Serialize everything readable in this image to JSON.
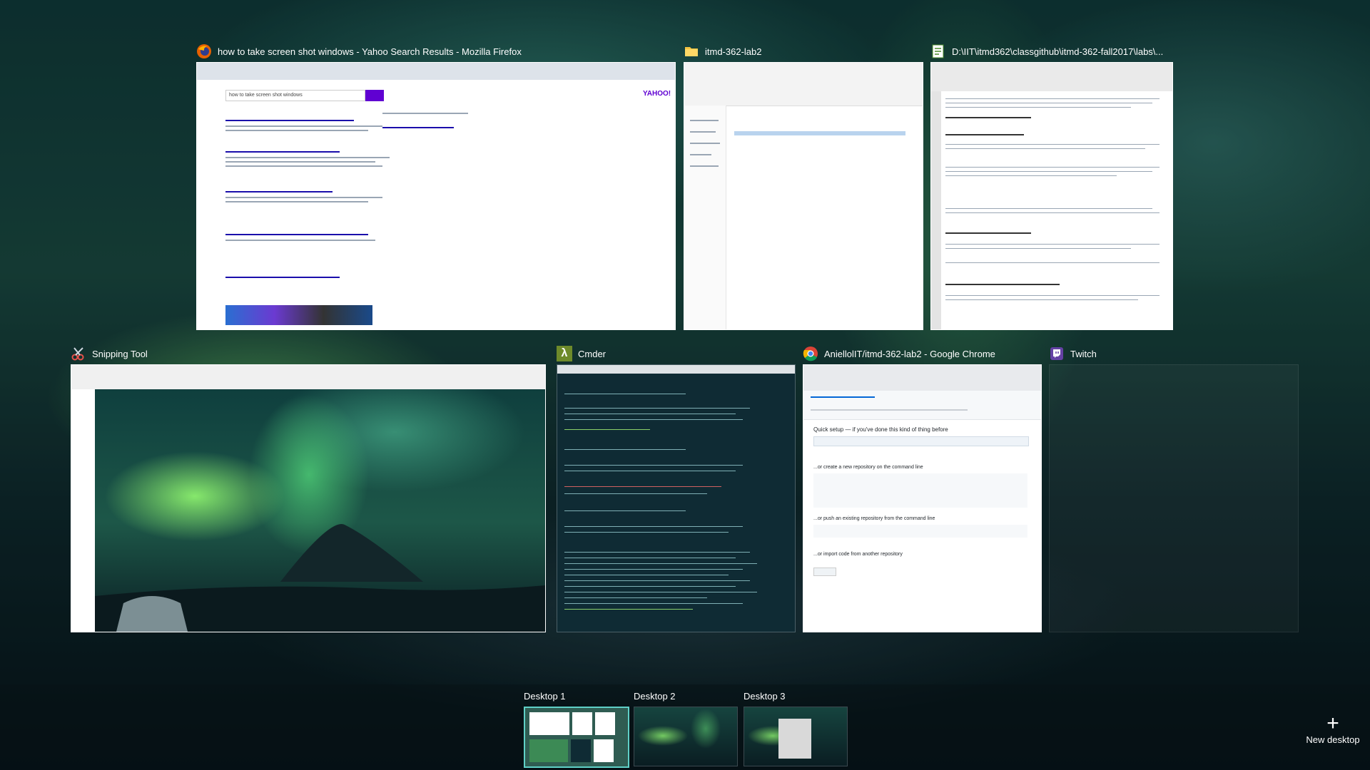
{
  "windows": {
    "firefox": {
      "title": "how to take screen shot windows - Yahoo Search Results - Mozilla Firefox",
      "icon": "firefox-icon"
    },
    "explorer": {
      "title": "itmd-362-lab2",
      "icon": "folder-icon"
    },
    "notepad": {
      "title": "D:\\IIT\\itmd362\\classgithub\\itmd-362-fall2017\\labs\\...",
      "icon": "notepad-plus-icon"
    },
    "snipping": {
      "title": "Snipping Tool",
      "icon": "scissors-icon"
    },
    "cmder": {
      "title": "Cmder",
      "icon": "lambda-icon"
    },
    "chrome": {
      "title": "AniellolIT/itmd-362-lab2 - Google Chrome",
      "icon": "chrome-icon"
    },
    "twitch": {
      "title": "Twitch",
      "icon": "twitch-icon"
    }
  },
  "thumb_text": {
    "yahoo_query": "how to take screen shot windows",
    "yahoo_brand": "YAHOO!",
    "github_quick": "Quick setup — if you've done this kind of thing before",
    "github_create": "...or create a new repository on the command line",
    "github_push": "...or push an existing repository from the command line",
    "github_import": "...or import code from another repository"
  },
  "desktops": [
    {
      "label": "Desktop 1",
      "active": true
    },
    {
      "label": "Desktop 2",
      "active": false
    },
    {
      "label": "Desktop 3",
      "active": false
    }
  ],
  "new_desktop_label": "New desktop",
  "colors": {
    "accent": "#5fd0c7",
    "cmder_bg": "#0f2b34",
    "yahoo_purple": "#6001d2"
  }
}
